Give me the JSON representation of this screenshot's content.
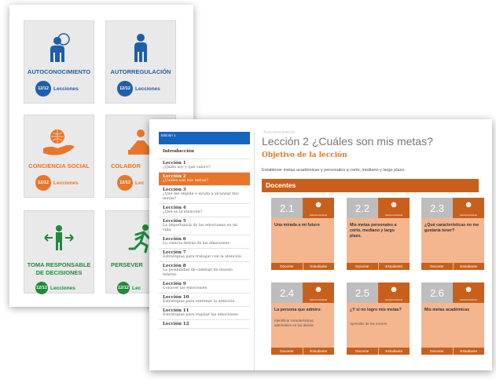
{
  "categories": [
    {
      "title": "AUTOCONOCIMIENTO",
      "lessons_label": "Lecciones",
      "badge": "12/12",
      "color": "#1e5fa8",
      "icon": "person-thought-icon"
    },
    {
      "title": "AUTORREGULACIÓN",
      "lessons_label": "Lecciones",
      "badge": "12/12",
      "color": "#1e5fa8",
      "icon": "person-standing-icon"
    },
    {
      "title": "CONCIENCIA SOCIAL",
      "lessons_label": "Lecciones",
      "badge": "12/12",
      "color": "#e8762a",
      "icon": "globe-hand-icon"
    },
    {
      "title": "COLABOR",
      "lessons_label": "Lec",
      "badge": "12/12",
      "color": "#e8762a",
      "icon": "collaboration-icon"
    },
    {
      "title": "TOMA RESPONSABLE DE DECISIONES",
      "lessons_label": "Lecciones",
      "badge": "12/12",
      "color": "#1e8a3a",
      "icon": "person-arrows-icon"
    },
    {
      "title": "PERSEVER",
      "lessons_label": "Lec",
      "badge": "12/12",
      "color": "#1e8a3a",
      "icon": "runner-icon"
    }
  ],
  "sidebar": {
    "top_label": "Edición 1",
    "items": [
      {
        "title": "Introducción",
        "sub": ""
      },
      {
        "title": "Lección 1",
        "sub": "¿Quién soy y qué valoro?"
      },
      {
        "title": "Lección 2",
        "sub": "¿Cuáles son mis metas?",
        "active": true
      },
      {
        "title": "Lección 3",
        "sub": "¿Qué me impide o ayuda a alcanzar mis metas?"
      },
      {
        "title": "Lección 4",
        "sub": "¿Qué es la atención?"
      },
      {
        "title": "Lección 5",
        "sub": "La importancia de las emociones en mi vida"
      },
      {
        "title": "Lección 6",
        "sub": "La ciencia detrás de las emociones"
      },
      {
        "title": "Lección 7",
        "sub": "Estrategias para trabajar con la atención"
      },
      {
        "title": "Lección 8",
        "sub": "La posibilidad de cambiar mi mundo interno"
      },
      {
        "title": "Lección 9",
        "sub": "Conocer las emociones"
      },
      {
        "title": "Lección 10",
        "sub": "Estrategias para entrenar la atención"
      },
      {
        "title": "Lección 11",
        "sub": "Estrategias para regular las emociones"
      },
      {
        "title": "Lección 12",
        "sub": ""
      }
    ]
  },
  "lesson": {
    "header_faint": "Autoconocimiento",
    "title": "Lección 2 ¿Cuáles son mis metas?",
    "objective_heading": "Objetivo de la lección",
    "objective_text": "Establecer metas académicas y personales a corto, mediano y largo plazo.",
    "section_heading": "Docentes"
  },
  "cards": [
    {
      "num": "2.1",
      "title": "Una mirada a mi futuro",
      "sub": "",
      "icon_label": "Autoconocimiento"
    },
    {
      "num": "2.2",
      "title": "Mis metas personales a corto, mediano y largo plazo.",
      "sub": "",
      "icon_label": "Autoconocimiento"
    },
    {
      "num": "2.3",
      "title": "¿Qué características no me gustaría tener?",
      "sub": "",
      "icon_label": "Autoconocimiento"
    },
    {
      "num": "2.4",
      "title": "La persona que admiro:",
      "sub": "Identificar características admirables en los demás",
      "icon_label": "Autoconocimiento"
    },
    {
      "num": "2.5",
      "title": "¿Y si no logro mis metas?",
      "sub": "Aprender de los errores",
      "icon_label": "Autoconocimiento"
    },
    {
      "num": "2.6",
      "title": "Mis metas académicas",
      "sub": "",
      "icon_label": "Autoconocimiento"
    }
  ],
  "card_buttons": {
    "docente": "Docente",
    "estudiante": "Estudiante"
  }
}
